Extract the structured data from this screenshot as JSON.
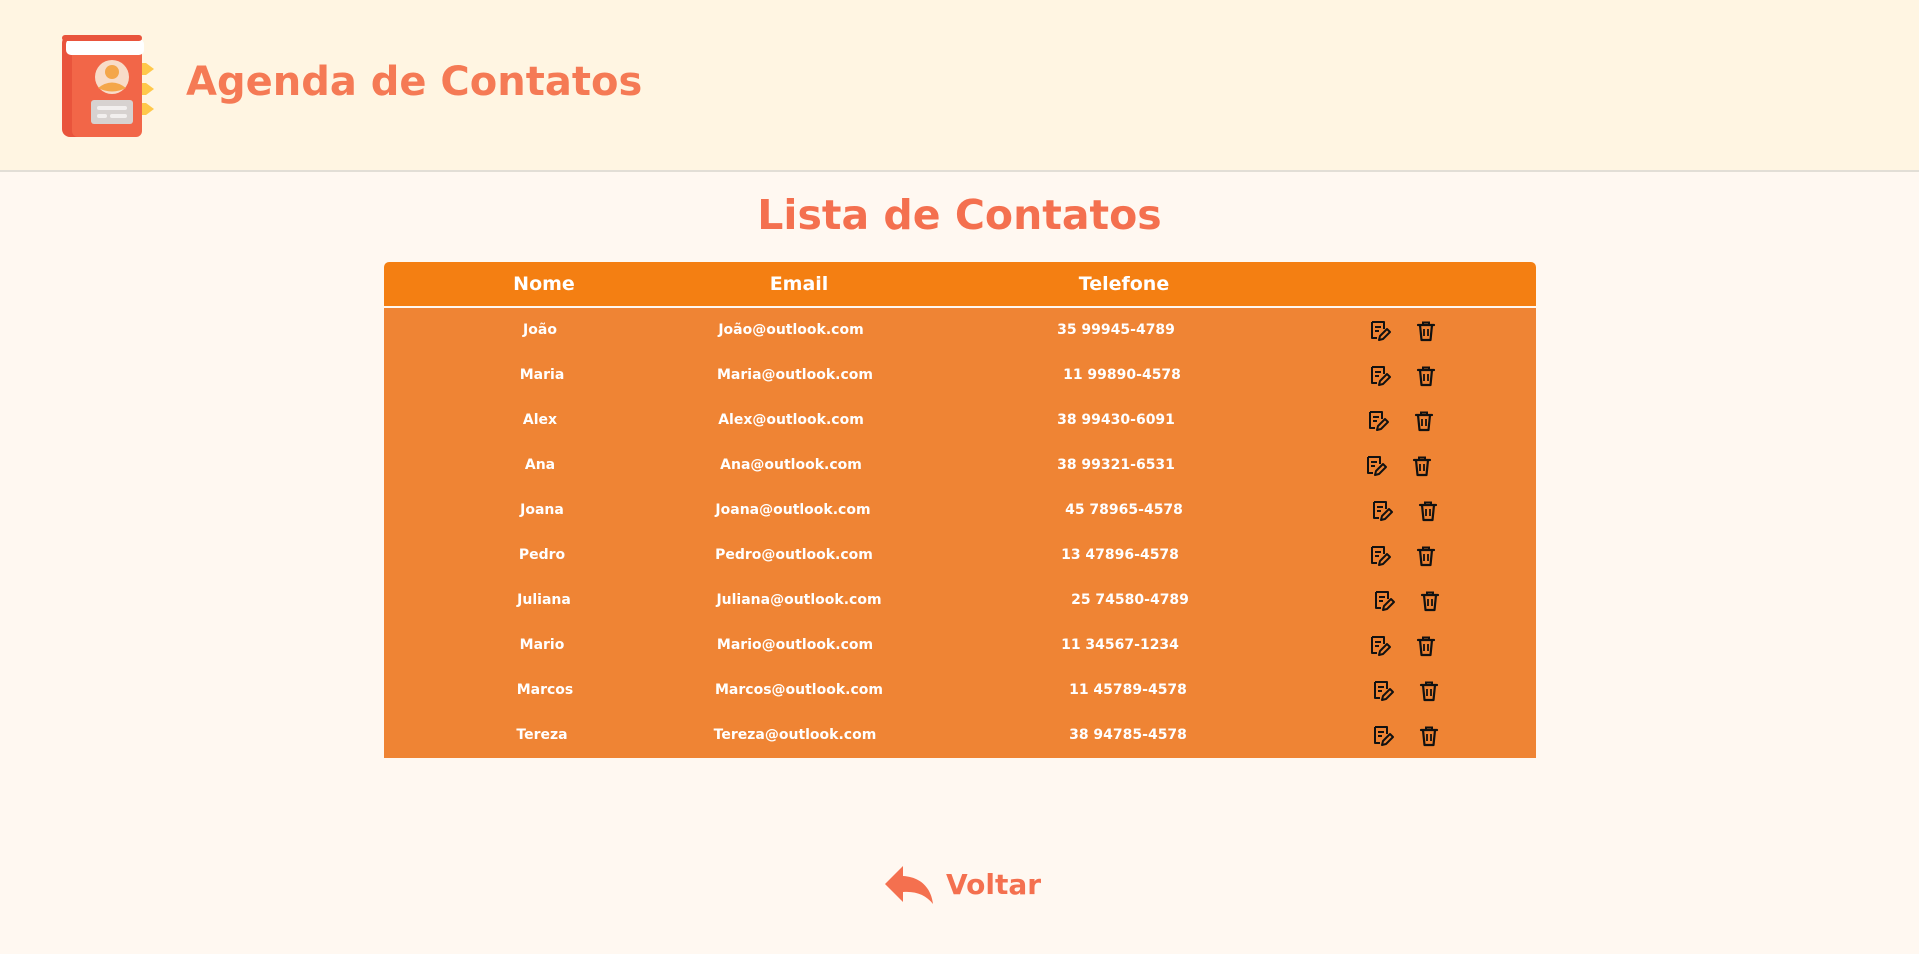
{
  "header": {
    "app_title": "Agenda de Contatos",
    "logo_icon": "address-book-icon"
  },
  "main": {
    "page_title": "Lista de Contatos",
    "table": {
      "columns": [
        "Nome",
        "Email",
        "Telefone",
        ""
      ],
      "rows": [
        {
          "name": "João",
          "email": "João@outlook.com",
          "phone": "35 99945-4789"
        },
        {
          "name": "Maria",
          "email": "Maria@outlook.com",
          "phone": "11 99890-4578"
        },
        {
          "name": "Alex",
          "email": "Alex@outlook.com",
          "phone": "38 99430-6091"
        },
        {
          "name": "Ana",
          "email": "Ana@outlook.com",
          "phone": "38 99321-6531"
        },
        {
          "name": "Joana",
          "email": "Joana@outlook.com",
          "phone": "45 78965-4578"
        },
        {
          "name": "Pedro",
          "email": "Pedro@outlook.com",
          "phone": "13 47896-4578"
        },
        {
          "name": "Juliana",
          "email": "Juliana@outlook.com",
          "phone": "25 74580-4789"
        },
        {
          "name": "Mario",
          "email": "Mario@outlook.com",
          "phone": "11 34567-1234"
        },
        {
          "name": "Marcos",
          "email": "Marcos@outlook.com",
          "phone": "11 45789-4578"
        },
        {
          "name": "Tereza",
          "email": "Tereza@outlook.com",
          "phone": "38 94785-4578"
        }
      ],
      "row_actions": [
        "edit-icon",
        "trash-icon"
      ]
    },
    "back_label": "Voltar",
    "back_icon": "reply-arrow-icon"
  },
  "colors": {
    "header_bg": "#fff5e2",
    "page_bg": "#fff8f1",
    "accent_text": "#f4704f",
    "table_header_bg": "#f47f12",
    "table_body_bg": "#ef8434"
  }
}
